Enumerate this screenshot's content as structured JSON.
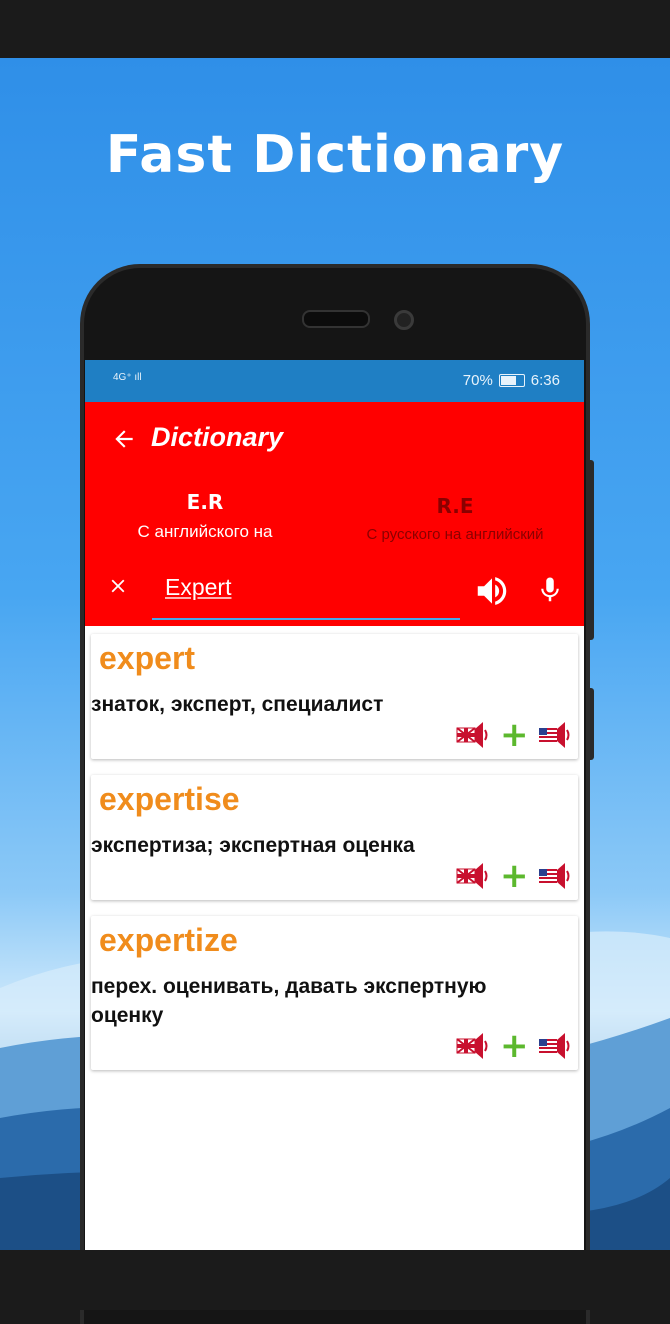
{
  "promo": {
    "headline": "Fast Dictionary"
  },
  "status_bar": {
    "signal": "4G⁺ ıll",
    "battery": "70%",
    "battery_level": 0.7,
    "time": "6:36"
  },
  "app_bar": {
    "title": "Dictionary",
    "back_icon": "arrow-left-icon"
  },
  "tabs": [
    {
      "code": "E.R",
      "desc": "С английского на"
    },
    {
      "code": "R.E",
      "desc": "С русского на английский"
    }
  ],
  "search": {
    "value": "Expert",
    "clear_icon": "close-icon",
    "speak_icon": "speaker-icon",
    "voice_icon": "microphone-icon"
  },
  "results": [
    {
      "word": "expert",
      "translation": "знаток, эксперт, специалист"
    },
    {
      "word": "expertise",
      "translation": "экспертиза; экспертная оценка"
    },
    {
      "word": "expertize",
      "translation": "перех. оценивать, давать экспертную оценку"
    }
  ],
  "colors": {
    "app_bar": "#ff0000",
    "status_bar": "#1f7fc4",
    "word": "#f08c1c",
    "add": "#5cb82e"
  }
}
